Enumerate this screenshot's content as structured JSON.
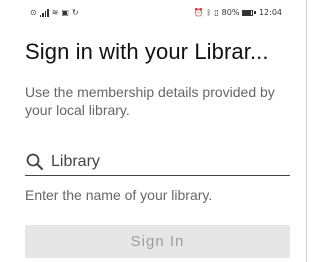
{
  "status_bar": {
    "left_icons": [
      "notification-icon",
      "signal-icon",
      "wifi-icon",
      "nfc-icon",
      "sync-icon"
    ],
    "right_icons": [
      "alarm-icon",
      "bluetooth-icon",
      "vibrate-icon"
    ],
    "battery_percent": "80%",
    "time": "12:04"
  },
  "screen": {
    "title": "Sign in with your Librar...",
    "description": "Use the membership details provided by your local library.",
    "search": {
      "placeholder": "Library",
      "value": "",
      "icon": "search-icon"
    },
    "hint": "Enter the name of your library.",
    "sign_in_label": "Sign In",
    "sign_in_enabled": false
  },
  "colors": {
    "button_bg": "#e6e6e6",
    "button_text": "#9e9e9e",
    "secondary_text": "#666666",
    "primary_text": "#111111"
  }
}
